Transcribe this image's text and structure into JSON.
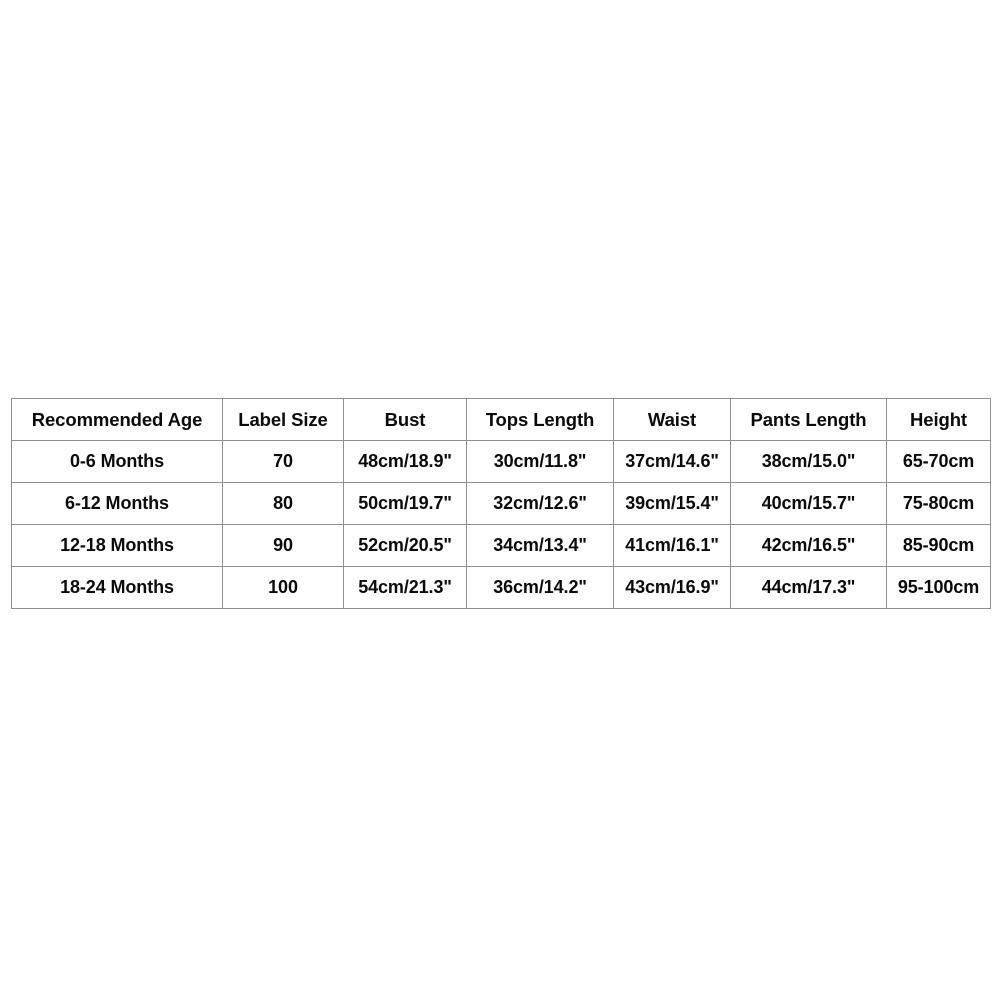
{
  "chart_data": {
    "type": "table",
    "title": "",
    "columns": [
      "Recommended Age",
      "Label Size",
      "Bust",
      "Tops Length",
      "Waist",
      "Pants Length",
      "Height"
    ],
    "rows": [
      [
        "0-6 Months",
        "70",
        "48cm/18.9\"",
        "30cm/11.8\"",
        "37cm/14.6\"",
        "38cm/15.0\"",
        "65-70cm"
      ],
      [
        "6-12 Months",
        "80",
        "50cm/19.7\"",
        "32cm/12.6\"",
        "39cm/15.4\"",
        "40cm/15.7\"",
        "75-80cm"
      ],
      [
        "12-18 Months",
        "90",
        "52cm/20.5\"",
        "34cm/13.4\"",
        "41cm/16.1\"",
        "42cm/16.5\"",
        "85-90cm"
      ],
      [
        "18-24 Months",
        "100",
        "54cm/21.3\"",
        "36cm/14.2\"",
        "43cm/16.9\"",
        "44cm/17.3\"",
        "95-100cm"
      ]
    ]
  },
  "style": {
    "background": "#ffffff",
    "border_color": "#8f8f8f",
    "text_color": "#0a0a0a"
  }
}
